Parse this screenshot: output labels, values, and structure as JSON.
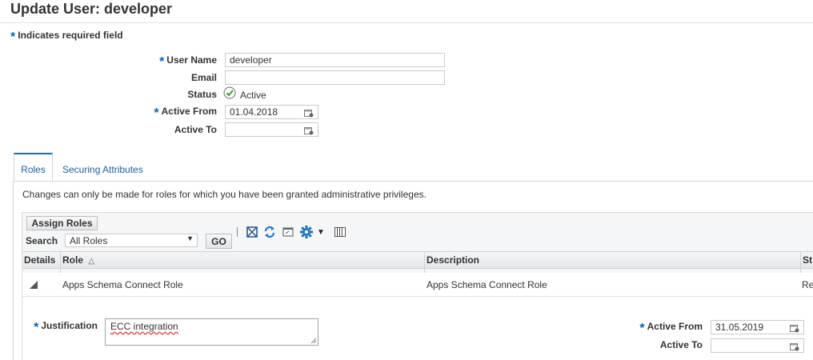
{
  "page": {
    "title": "Update User: developer",
    "required_note": "Indicates required field",
    "required_marker": "*"
  },
  "form": {
    "user_name_label": "User Name",
    "user_name_value": "developer",
    "email_label": "Email",
    "email_value": "",
    "status_label": "Status",
    "status_value": "Active",
    "active_from_label": "Active From",
    "active_from_value": "01.04.2018",
    "active_to_label": "Active To",
    "active_to_value": ""
  },
  "tabs": [
    {
      "label": "Roles",
      "active": true
    },
    {
      "label": "Securing Attributes",
      "active": false
    }
  ],
  "roles": {
    "info": "Changes can only be made for roles for which you have been granted administrative privileges.",
    "assign_button": "Assign Roles",
    "search_label": "Search",
    "search_selected": "All Roles",
    "go_button": "GO",
    "toolbar_icons": [
      "detach-icon",
      "refresh-icon",
      "export-icon",
      "gear-icon",
      "columns-icon"
    ],
    "columns": [
      "Details",
      "Role",
      "Description",
      "St"
    ],
    "rows": [
      {
        "role": "Apps Schema Connect Role",
        "description": "Apps Schema Connect Role",
        "status": "Re"
      }
    ],
    "detail": {
      "justification_label": "Justification",
      "justification_value": "ECC integration",
      "active_from_label": "Active From",
      "active_from_value": "31.05.2019",
      "active_to_label": "Active To",
      "active_to_value": ""
    }
  },
  "colors": {
    "accent": "#0b63b5",
    "tab_link": "#1f5e99",
    "status_check": "#3f9a2f"
  }
}
